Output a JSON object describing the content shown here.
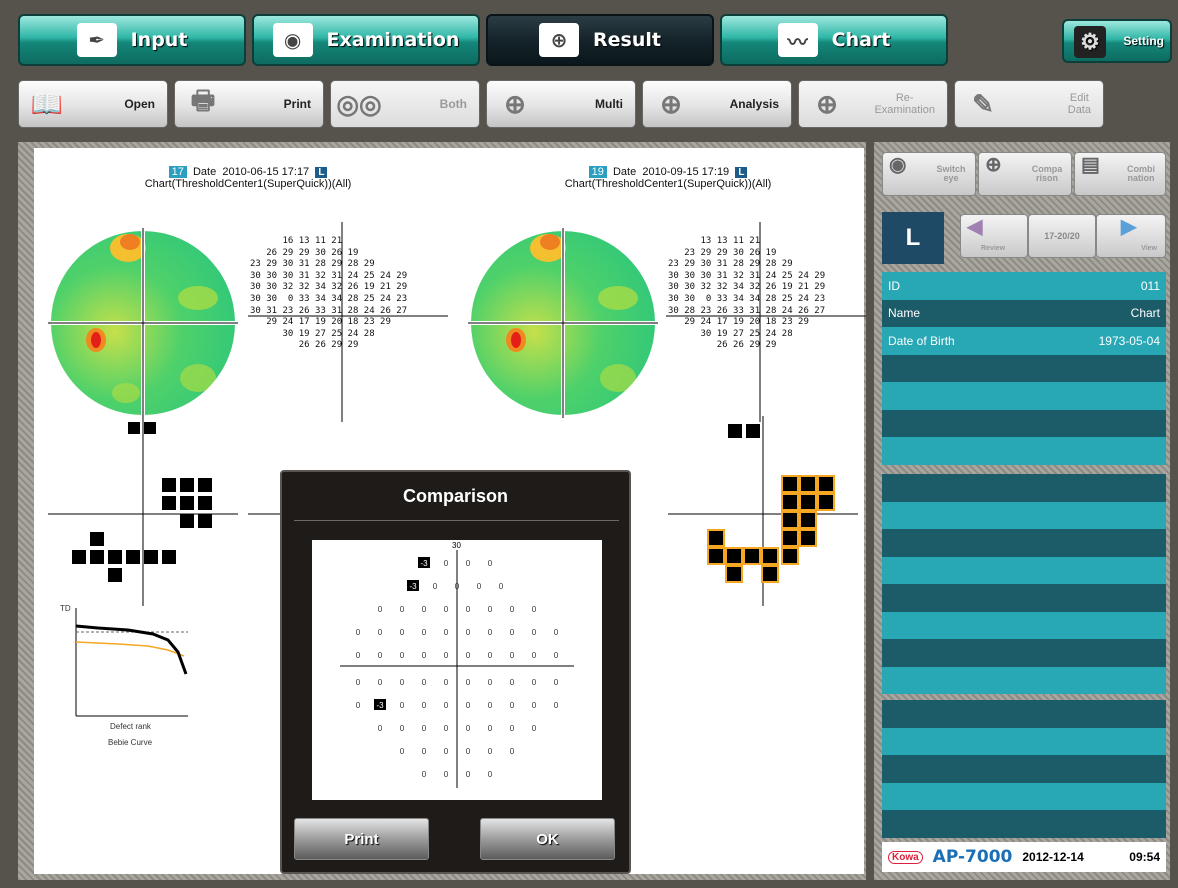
{
  "tabs": [
    {
      "label": "Input",
      "icon": "pen-icon"
    },
    {
      "label": "Examination",
      "icon": "examination-icon"
    },
    {
      "label": "Result",
      "icon": "result-icon"
    },
    {
      "label": "Chart",
      "icon": "chart-icon"
    }
  ],
  "setting_label": "Setting",
  "toolbar": {
    "open": "Open",
    "print": "Print",
    "both": "Both",
    "multi": "Multi",
    "analysis": "Analysis",
    "reexam_1": "Re-",
    "reexam_2": "Examination",
    "edit_1": "Edit",
    "edit_2": "Data"
  },
  "left_chart": {
    "test_no": "17",
    "date_label": "Date",
    "date": "2010-06-15 17:17",
    "eye": "L",
    "program": "Chart(ThresholdCenter1(SuperQuick))(All)"
  },
  "right_chart": {
    "test_no": "19",
    "date_label": "Date",
    "date": "2010-09-15 17:19",
    "eye": "L",
    "program": "Chart(ThresholdCenter1(SuperQuick))(All)"
  },
  "threshold_left": [
    "      16 13 11 21",
    "   26 29 29 30 26 19",
    "23 29 30 31 28 29 28 29",
    "30 30 30 31 32 31 24 25 24 29",
    "30 30 32 32 34 32 26 19 21 29",
    "30 30  0 33 34 34 28 25 24 23",
    "30 31 23 26 33 31 28 24 26 27",
    "   29 24 17 19 20 18 23 29",
    "      30 19 27 25 24 28",
    "         26 26 29 29"
  ],
  "threshold_right": [
    "      13 13 11 21",
    "   23 29 29 30 26 19",
    "23 29 30 31 28 29 28 29",
    "30 30 30 31 32 31 24 25 24 29",
    "30 30 32 32 34 32 26 19 21 29",
    "30 30  0 33 34 34 28 25 24 23",
    "30 28 23 26 33 31 28 24 26 27",
    "   29 24 17 19 20 18 23 29",
    "      30 19 27 25 24 28",
    "         26 26 29 29"
  ],
  "bebie": {
    "ylabel": "TD",
    "xlabel": "Defect rank",
    "title": "Bebie Curve"
  },
  "right_buttons": {
    "switch": "Switch eye",
    "compare": "Compa rison",
    "combi": "Combi nation",
    "review": "Review",
    "range": "17-20/20",
    "view": "View"
  },
  "eye_indicator": "L",
  "patient": [
    {
      "label": "ID",
      "value": "011"
    },
    {
      "label": "Name",
      "value": "Chart"
    },
    {
      "label": "Date of Birth",
      "value": "1973-05-04"
    }
  ],
  "footer": {
    "logo": "Kowa",
    "model": "AP-7000",
    "date": "2012-12-14",
    "time": "09:54"
  },
  "modal": {
    "title": "Comparison",
    "axis_label": "30",
    "print": "Print",
    "ok": "OK",
    "rows": [
      [
        "-3",
        "0",
        "0",
        "0"
      ],
      [
        "-3",
        "0",
        "0",
        "0",
        "0"
      ],
      [
        "0",
        "0",
        "0",
        "0",
        "0",
        "0",
        "0",
        "0"
      ],
      [
        "0",
        "0",
        "0",
        "0",
        "0",
        "0",
        "0",
        "0",
        "0",
        "0"
      ],
      [
        "0",
        "0",
        "0",
        "0",
        "0",
        "0",
        "0",
        "0",
        "0",
        "0"
      ],
      [
        "0",
        "0",
        "0",
        "0",
        "0",
        "0",
        "0",
        "0",
        "0",
        "0"
      ],
      [
        "0",
        "-3",
        "0",
        "0",
        "0",
        "0",
        "0",
        "0",
        "0",
        "0"
      ],
      [
        "0",
        "0",
        "0",
        "0",
        "0",
        "0",
        "0",
        "0"
      ],
      [
        "0",
        "0",
        "0",
        "0",
        "0",
        "0"
      ],
      [
        "0",
        "0",
        "0",
        "0"
      ]
    ]
  },
  "colors": {
    "teal": "#28a7b5",
    "dark_teal": "#1c5b68",
    "defect_border": "#f5a623"
  }
}
